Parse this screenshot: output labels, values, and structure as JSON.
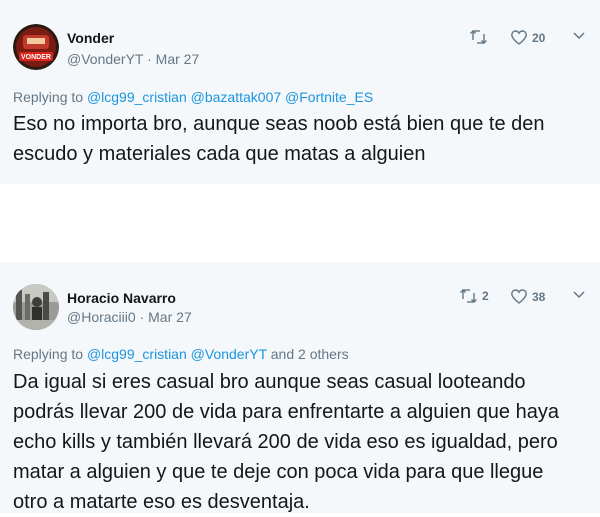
{
  "tweets": [
    {
      "name": "Vonder",
      "handle": "@VonderYT",
      "date": "Mar 27",
      "handle_line": "@VonderYT · Mar 27",
      "avatar_text": "VONDER",
      "retweets": "",
      "likes": "20",
      "replying_prefix": "Replying to",
      "mentions": [
        "@lcg99_cristian",
        "@bazattak007",
        "@Fortnite_ES"
      ],
      "replying_suffix": "",
      "text": "Eso no importa bro, aunque seas noob está bien que te den escudo y materiales cada que matas a alguien"
    },
    {
      "name": "Horacio Navarro",
      "handle": "@Horaciii0",
      "date": "Mar 27",
      "handle_line": "@Horaciii0 · Mar 27",
      "retweets": "2",
      "likes": "38",
      "replying_prefix": "Replying to",
      "mentions": [
        "@lcg99_cristian",
        "@VonderYT"
      ],
      "replying_suffix": "and 2 others",
      "text": "Da igual si eres casual bro aunque seas casual looteando podrás llevar 200 de vida para enfrentarte a alguien que haya echo kills y también llevará 200 de vida eso es igualdad, pero matar a alguien y que te deje con poca vida para que llegue otro a matarte eso es desventaja."
    }
  ],
  "colors": {
    "background": "#f5f8fa",
    "text": "#14171a",
    "secondary": "#657786",
    "link": "#1b95e0"
  }
}
